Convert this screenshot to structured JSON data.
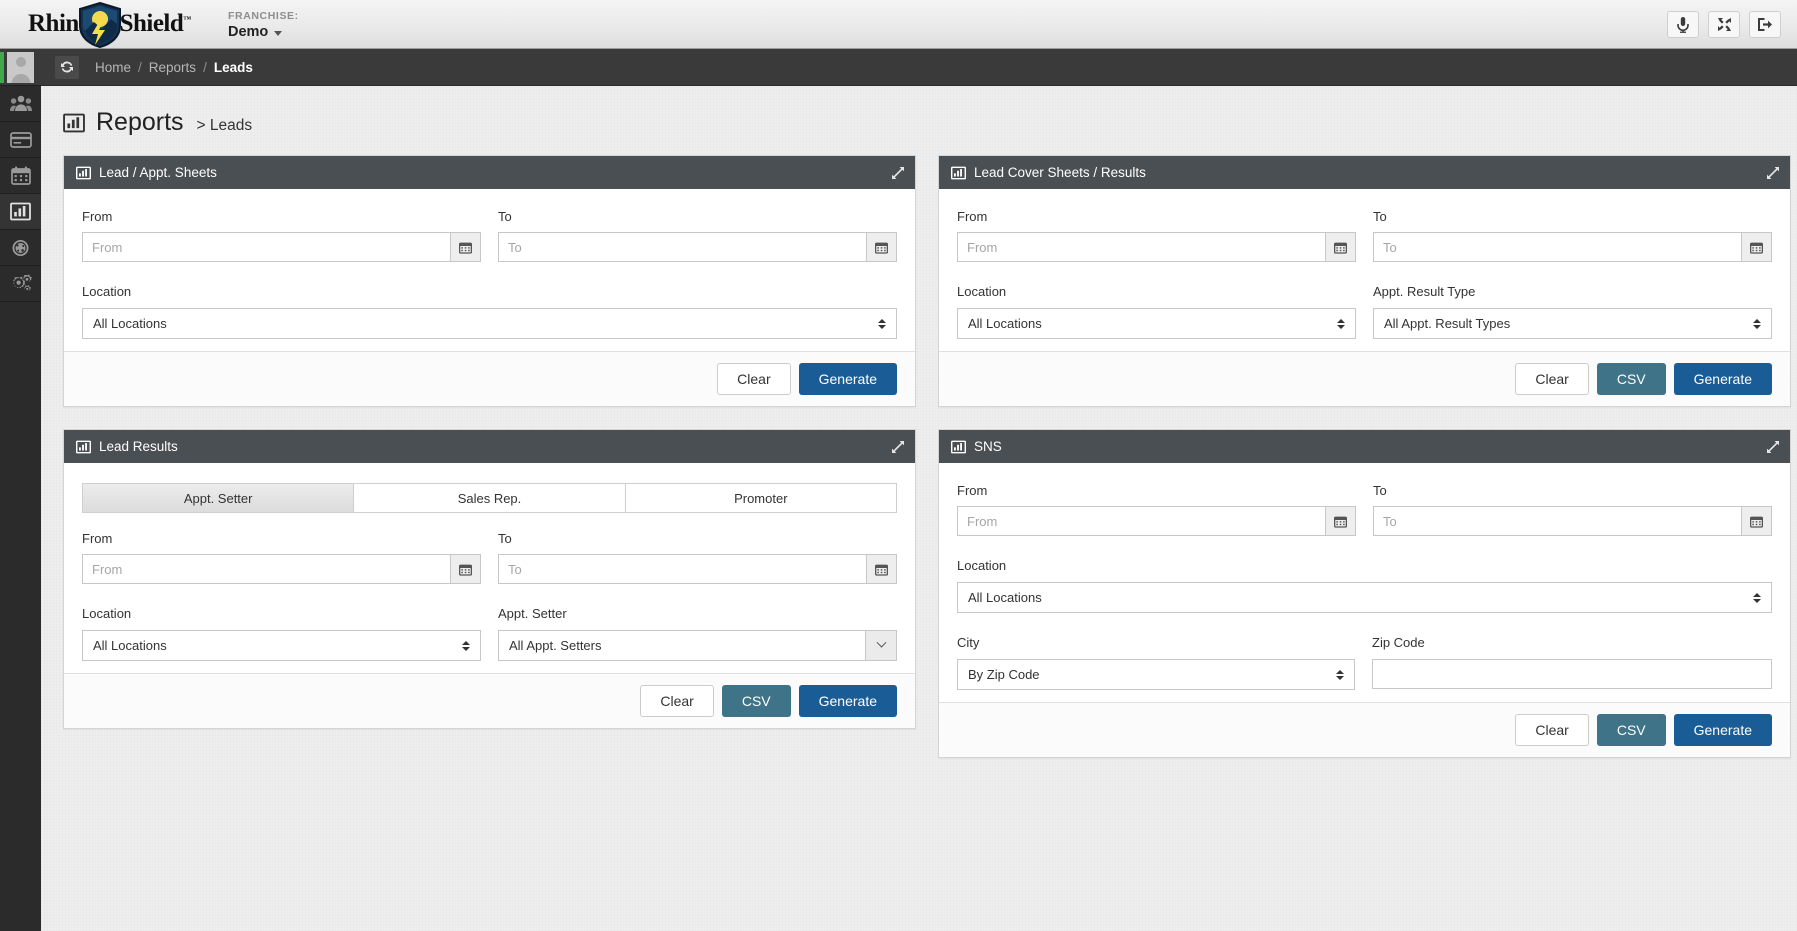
{
  "brand": {
    "name_left": "Rhino",
    "name_right": "Shield",
    "tm": "™"
  },
  "header": {
    "franchise_label": "FRANCHISE:",
    "franchise_value": "Demo",
    "actions": [
      {
        "name": "microphone-icon",
        "title": "Microphone"
      },
      {
        "name": "fullscreen-icon",
        "title": "Fullscreen"
      },
      {
        "name": "logout-icon",
        "title": "Log out"
      }
    ]
  },
  "sidebar": {
    "items": [
      {
        "icon": "avatar",
        "label": "Profile"
      },
      {
        "icon": "users-icon",
        "label": "Customers"
      },
      {
        "icon": "credit-card-icon",
        "label": "Billing"
      },
      {
        "icon": "calendar-icon",
        "label": "Calendar"
      },
      {
        "icon": "bar-chart-icon",
        "label": "Reports",
        "active": true
      },
      {
        "icon": "gauge-icon",
        "label": "Dashboard"
      },
      {
        "icon": "gears-icon",
        "label": "Settings"
      }
    ]
  },
  "breadcrumb": {
    "refresh": "refresh-icon",
    "items": [
      "Home",
      "Reports"
    ],
    "current": "Leads",
    "separator": "/"
  },
  "page": {
    "title": "Reports",
    "subtitle": "> Leads"
  },
  "common": {
    "label_from": "From",
    "label_to": "To",
    "label_location": "Location",
    "placeholder_from": "From",
    "placeholder_to": "To",
    "value_all_locations": "All Locations",
    "btn_clear": "Clear",
    "btn_csv": "CSV",
    "btn_generate": "Generate"
  },
  "panels": {
    "lead_appt_sheets": {
      "title": "Lead / Appt. Sheets",
      "from_label": "From",
      "to_label": "To",
      "from_placeholder": "From",
      "to_placeholder": "To",
      "location_label": "Location",
      "location_value": "All Locations",
      "buttons": {
        "clear": "Clear",
        "generate": "Generate"
      }
    },
    "lead_cover_sheets": {
      "title": "Lead Cover Sheets / Results",
      "from_label": "From",
      "to_label": "To",
      "from_placeholder": "From",
      "to_placeholder": "To",
      "location_label": "Location",
      "location_value": "All Locations",
      "result_type_label": "Appt. Result Type",
      "result_type_value": "All Appt. Result Types",
      "buttons": {
        "clear": "Clear",
        "csv": "CSV",
        "generate": "Generate"
      }
    },
    "lead_results": {
      "title": "Lead Results",
      "tabs": [
        {
          "label": "Appt. Setter",
          "active": true
        },
        {
          "label": "Sales Rep.",
          "active": false
        },
        {
          "label": "Promoter",
          "active": false
        }
      ],
      "from_label": "From",
      "to_label": "To",
      "from_placeholder": "From",
      "to_placeholder": "To",
      "location_label": "Location",
      "location_value": "All Locations",
      "setter_label": "Appt. Setter",
      "setter_value": "All Appt. Setters",
      "buttons": {
        "clear": "Clear",
        "csv": "CSV",
        "generate": "Generate"
      }
    },
    "sns": {
      "title": "SNS",
      "from_label": "From",
      "to_label": "To",
      "from_placeholder": "From",
      "to_placeholder": "To",
      "location_label": "Location",
      "location_value": "All Locations",
      "city_label": "City",
      "city_value": "By Zip Code",
      "zip_label": "Zip Code",
      "zip_value": "",
      "buttons": {
        "clear": "Clear",
        "csv": "CSV",
        "generate": "Generate"
      }
    }
  },
  "colors": {
    "panel_header": "#4a4f54",
    "generate": "#1a5d96",
    "csv": "#3e7388",
    "sidebar": "#2b2b2b",
    "crumbbar": "#3a3a3a"
  }
}
